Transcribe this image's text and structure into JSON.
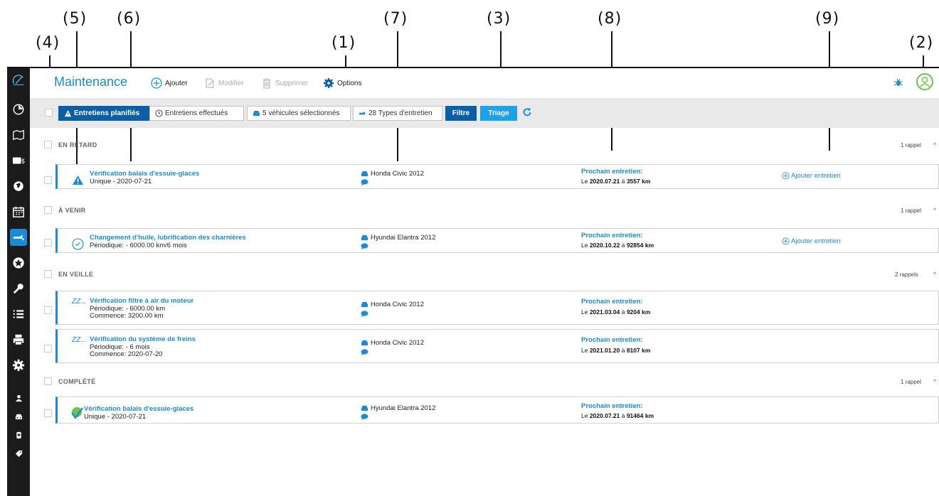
{
  "callouts": [
    "(1)",
    "(2)",
    "(3)",
    "(4)",
    "(5)",
    "(6)",
    "(7)",
    "(8)",
    "(9)"
  ],
  "header": {
    "title": "Maintenance",
    "add_label": "Ajouter",
    "edit_label": "Modifier",
    "delete_label": "Supprimer",
    "options_label": "Options"
  },
  "toolbar": {
    "planned_label": "Entretiens planifiés",
    "done_label": "Entretiens effectués",
    "vehicles_label": "5 véhicules sélectionnés",
    "types_label": "28 Types d'entretien",
    "filter_label": "Filtre",
    "sort_label": "Triage"
  },
  "sections": [
    {
      "title": "EN RETARD",
      "count": "1 rappel"
    },
    {
      "title": "À VENIR",
      "count": "1 rappel"
    },
    {
      "title": "EN VEILLE",
      "count": "2 rappels"
    },
    {
      "title": "COMPLÉTÉ",
      "count": "1 rappel"
    }
  ],
  "items": [
    {
      "title": "Vérification balais d'essuie-glaces",
      "line1": "Unique - 2020-07-21",
      "line2": "",
      "vehicle": "Honda Civic 2012",
      "next_label": "Prochain entretien:",
      "next_prefix": "Le ",
      "next_date": "2020.07.21",
      "next_mid": " à ",
      "next_km": "3557 km",
      "add_label": "Ajouter entretien",
      "status": "warning-icon"
    },
    {
      "title": "Changement d'huile, lubrification des charnières",
      "line1": "Périodique: - 6000.00 km/6 mois",
      "line2": "",
      "vehicle": "Hyundai Elantra 2012",
      "next_label": "Prochain entretien:",
      "next_prefix": "Le ",
      "next_date": "2020.10.22",
      "next_mid": " à ",
      "next_km": "92854 km",
      "add_label": "Ajouter entretien",
      "status": "clock-icon"
    },
    {
      "title": "Vérification filtre à air du moteur",
      "line1": "Périodique: - 6000.00 km",
      "line2": "Commence: 3200.00 km",
      "vehicle": "Honda Civic 2012",
      "next_label": "Prochain entretien:",
      "next_prefix": "Le ",
      "next_date": "2021.03.04",
      "next_mid": " à ",
      "next_km": "9204 km",
      "add_label": "",
      "status": "sleep-icon",
      "status_text": "ZZ..."
    },
    {
      "title": "Vérification du système de freins",
      "line1": "Périodique: - 6 mois",
      "line2": "Commence: 2020-07-20",
      "vehicle": "Honda Civic 2012",
      "next_label": "Prochain entretien:",
      "next_prefix": "Le ",
      "next_date": "2021.01.20",
      "next_mid": " à ",
      "next_km": "8107 km",
      "add_label": "",
      "status": "sleep-icon",
      "status_text": "ZZ..."
    },
    {
      "title": "Vérification balais d'essuie-glaces",
      "line1": "Unique - 2020-07-21",
      "line2": "",
      "vehicle": "Hyundai Elantra 2012",
      "next_label": "Prochain entretien:",
      "next_prefix": "Le ",
      "next_date": "2020.07.21",
      "next_mid": " à ",
      "next_km": "91464 km",
      "add_label": "",
      "status": "check-icon"
    }
  ],
  "colors": {
    "accent": "#1a8bd4",
    "primary_button": "#0b5fa6",
    "sort_button": "#1ca2e6",
    "sidebar": "#1b1b1b",
    "complete": "#6cc24a"
  }
}
